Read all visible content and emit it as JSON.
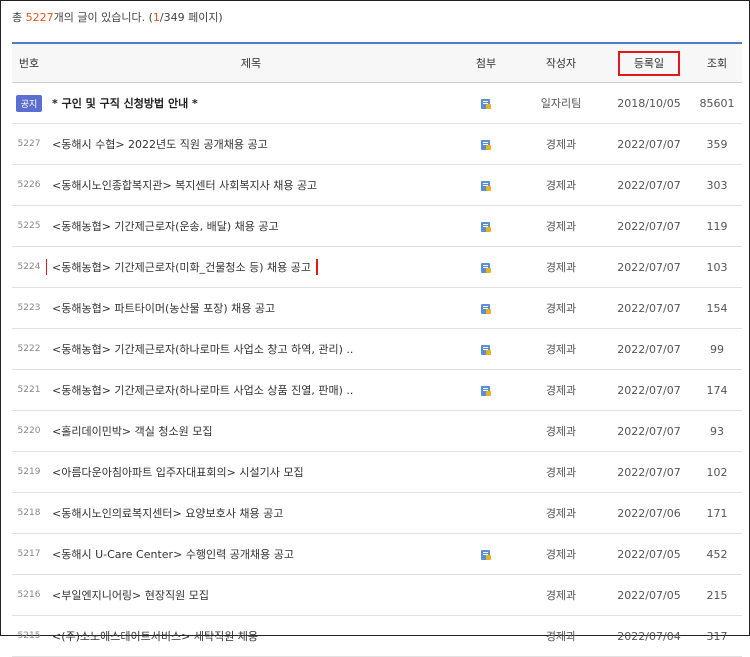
{
  "summary": {
    "prefix": "총",
    "total": "5227",
    "middle": "개의 글이 있습니다. (",
    "page": "1",
    "suffix": "/349 페이지)"
  },
  "columns": {
    "num": "번호",
    "title": "제목",
    "attach": "첨부",
    "author": "작성자",
    "date": "등록일",
    "views": "조회"
  },
  "notice": {
    "badge": "공지",
    "title": "* 구인 및 구직 신청방법 안내 *",
    "author": "일자리팀",
    "date": "2018/10/05",
    "views": "85601",
    "attach_icon": "attachment-icon"
  },
  "posts": [
    {
      "num": "5227",
      "title": "<동해시 수협> 2022년도 직원 공개채용 공고",
      "author": "경제과",
      "date": "2022/07/07",
      "views": "359",
      "has_attachment": true
    },
    {
      "num": "5226",
      "title": "<동해시노인종합복지관> 복지센터 사회복지사 채용 공고",
      "author": "경제과",
      "date": "2022/07/07",
      "views": "303",
      "has_attachment": true
    },
    {
      "num": "5225",
      "title": "<동해농협> 기간제근로자(운송, 배달) 채용 공고",
      "author": "경제과",
      "date": "2022/07/07",
      "views": "119",
      "has_attachment": true
    },
    {
      "num": "5224",
      "title": "<동해농협> 기간제근로자(미화_건물청소 등) 채용 공고",
      "author": "경제과",
      "date": "2022/07/07",
      "views": "103",
      "has_attachment": true
    },
    {
      "num": "5223",
      "title": "<동해농협> 파트타이머(농산물 포장) 채용 공고",
      "author": "경제과",
      "date": "2022/07/07",
      "views": "154",
      "has_attachment": true
    },
    {
      "num": "5222",
      "title": "<동해농협> 기간제근로자(하나로마트 사업소 창고 하역, 관리) ..",
      "author": "경제과",
      "date": "2022/07/07",
      "views": "99",
      "has_attachment": true
    },
    {
      "num": "5221",
      "title": "<동해농협> 기간제근로자(하나로마트 사업소 상품 진열, 판매) ..",
      "author": "경제과",
      "date": "2022/07/07",
      "views": "174",
      "has_attachment": true
    },
    {
      "num": "5220",
      "title": "<홀리데이민박> 객실 청소원 모집",
      "author": "경제과",
      "date": "2022/07/07",
      "views": "93",
      "has_attachment": false
    },
    {
      "num": "5219",
      "title": "<아름다운아침아파트 입주자대표회의> 시설기사 모집",
      "author": "경제과",
      "date": "2022/07/07",
      "views": "102",
      "has_attachment": false
    },
    {
      "num": "5218",
      "title": "<동해시노인의료복지센터> 요양보호사 채용 공고",
      "author": "경제과",
      "date": "2022/07/06",
      "views": "171",
      "has_attachment": false
    },
    {
      "num": "5217",
      "title": "<동해시 U-Care Center> 수행인력 공개채용 공고",
      "author": "경제과",
      "date": "2022/07/05",
      "views": "452",
      "has_attachment": true
    },
    {
      "num": "5216",
      "title": "<부일엔지니어링> 현장직원 모집",
      "author": "경제과",
      "date": "2022/07/05",
      "views": "215",
      "has_attachment": false
    },
    {
      "num": "5215",
      "title": "<(주)소노에스테이트서비스> 세탁직원 채용",
      "author": "경제과",
      "date": "2022/07/04",
      "views": "317",
      "has_attachment": false
    }
  ],
  "highlight_color": "#e01919"
}
